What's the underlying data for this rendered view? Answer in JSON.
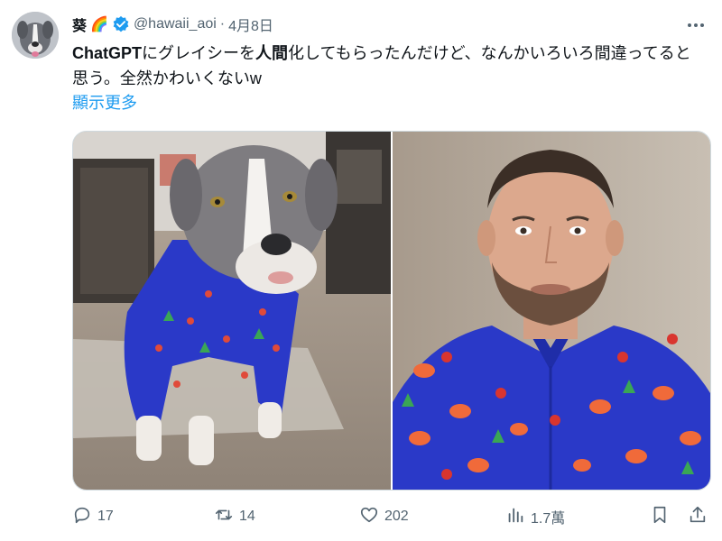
{
  "tweet": {
    "display_name": "葵",
    "name_emoji": "🌈",
    "handle": "@hawaii_aoi",
    "separator": "·",
    "date": "4月8日",
    "text_parts": {
      "p1": "ChatGPT",
      "p2": "にグレイシーを",
      "p3": "人間",
      "p4": "化してもらったんだけど、なんかいろいろ間違ってると思う。全然かわいくないw"
    },
    "show_more": "顯示更多"
  },
  "metrics": {
    "replies": "17",
    "retweets": "14",
    "likes": "202",
    "views": "1.7萬"
  },
  "colors": {
    "link": "#1d9bf0",
    "secondary_text": "#536471",
    "verified_badge": "#1d9bf0",
    "shirt_blue": "#2a39c8"
  },
  "icons": {
    "more": "more-icon",
    "verified": "verified-badge-icon",
    "reply": "reply-icon",
    "retweet": "retweet-icon",
    "like": "heart-icon",
    "views": "views-icon",
    "bookmark": "bookmark-icon",
    "share": "share-icon"
  }
}
